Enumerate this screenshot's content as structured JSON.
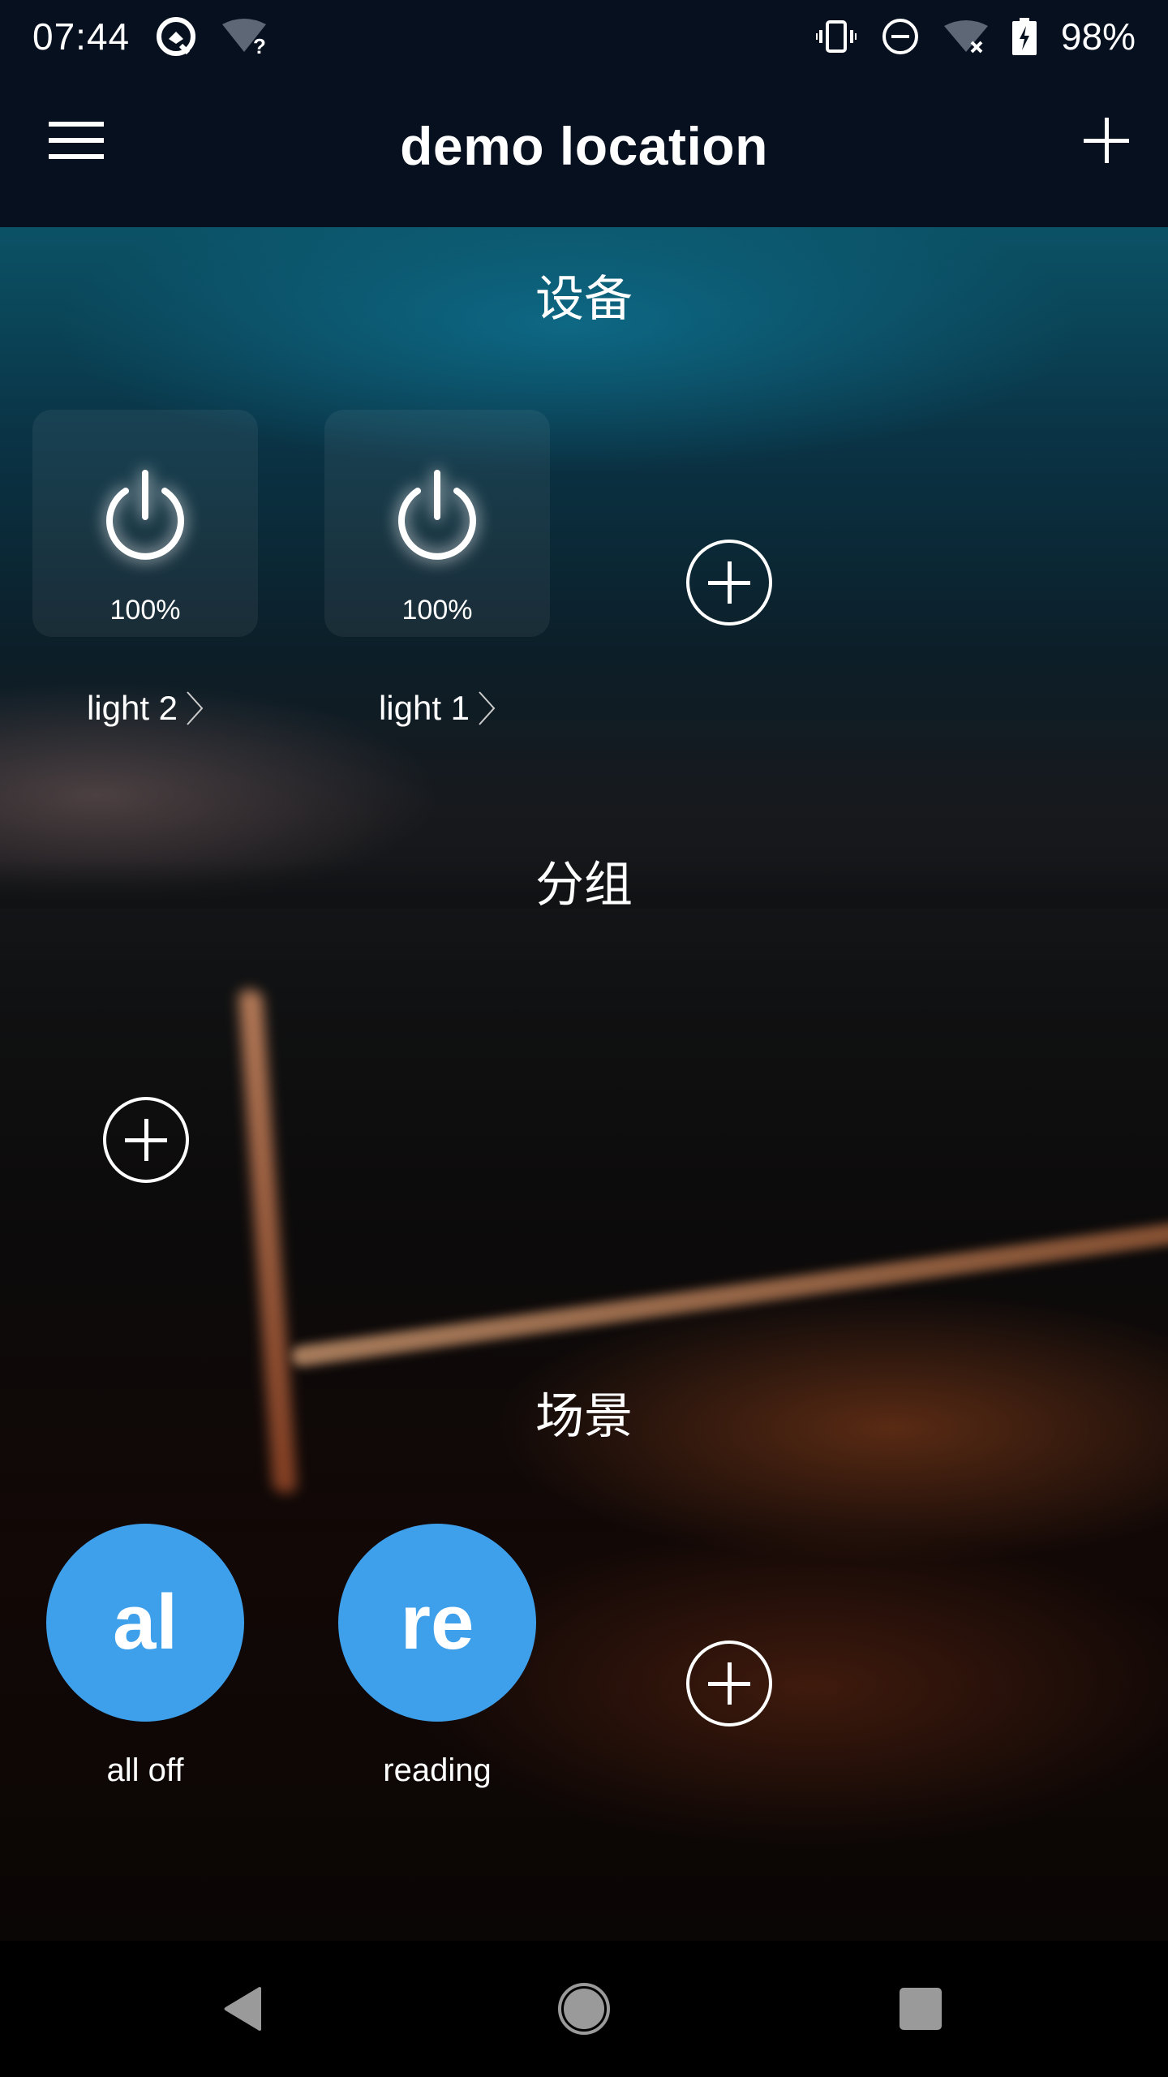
{
  "status_bar": {
    "time": "07:44",
    "battery_percent": "98%",
    "left_icons": [
      "app-notification-icon",
      "wifi-unknown-icon"
    ],
    "right_icons": [
      "vibrate-icon",
      "do-not-disturb-icon",
      "wifi-off-icon",
      "battery-charging-icon"
    ]
  },
  "app_bar": {
    "title": "demo location",
    "menu_icon": "hamburger-menu-icon",
    "add_icon": "plus-icon"
  },
  "sections": {
    "devices": {
      "title": "设备",
      "items": [
        {
          "name": "light 2",
          "brightness": "100%",
          "state": "on"
        },
        {
          "name": "light 1",
          "brightness": "100%",
          "state": "on"
        }
      ],
      "add_icon": "add-circle-icon"
    },
    "groups": {
      "title": "分组",
      "items": [],
      "add_icon": "add-circle-icon"
    },
    "scenes": {
      "title": "场景",
      "items": [
        {
          "abbr": "al",
          "name": "all off"
        },
        {
          "abbr": "re",
          "name": "reading"
        }
      ],
      "add_icon": "add-circle-icon"
    }
  },
  "colors": {
    "app_bar_bg": "#06101f",
    "scene_accent": "#3e9fea",
    "text": "#ffffff",
    "nav_icons": "#9a9a9a"
  },
  "nav_bar": {
    "icons": [
      "back-icon",
      "home-icon",
      "recents-icon"
    ]
  }
}
